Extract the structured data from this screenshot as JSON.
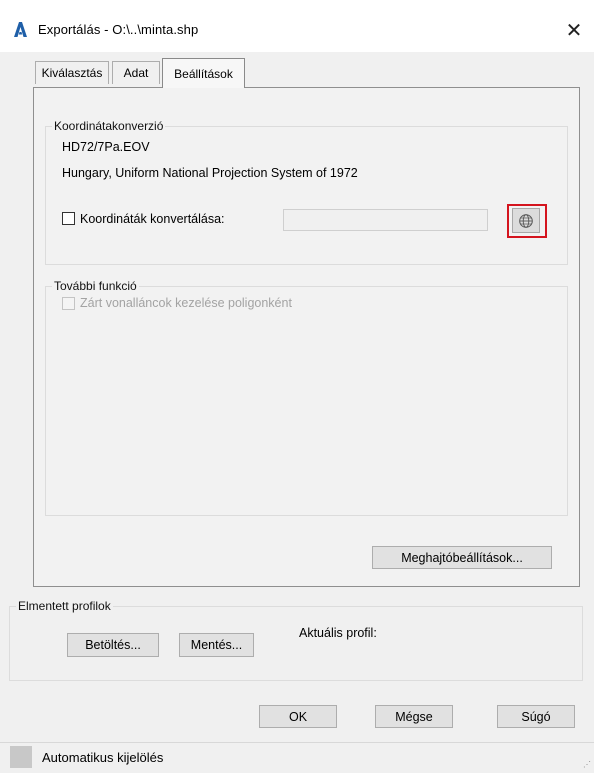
{
  "window": {
    "title": "Exportálás - O:\\..\\minta.shp",
    "close_glyph": "✕"
  },
  "tabs": [
    {
      "label": "Kiválasztás",
      "selected": false
    },
    {
      "label": "Adat",
      "selected": false
    },
    {
      "label": "Beállítások",
      "selected": true
    }
  ],
  "coordinate_conversion": {
    "legend": "Koordinátakonverzió",
    "code": "HD72/7Pa.EOV",
    "description": "Hungary, Uniform National Projection System of 1972",
    "checkbox_label": "Koordináták konvertálása:",
    "checked": false,
    "input_value": "",
    "globe_button_icon": "globe-icon",
    "highlight_color": "#d4141e"
  },
  "more_functions": {
    "legend": "További funkció",
    "checkbox_label": "Zárt vonalláncok kezelése poligonként",
    "checked": false,
    "disabled": true
  },
  "driver_settings_button": "Meghajtóbeállítások...",
  "saved_profiles": {
    "legend": "Elmentett profilok",
    "load_button": "Betöltés...",
    "save_button": "Mentés...",
    "current_profile_label": "Aktuális profil:"
  },
  "footer_buttons": {
    "ok": "OK",
    "cancel": "Mégse",
    "help": "Súgó"
  },
  "status_bar": {
    "text": "Automatikus kijelölés"
  },
  "colors": {
    "app_icon": "#1f5fa8",
    "dialog_bg": "#f0f0f0"
  }
}
